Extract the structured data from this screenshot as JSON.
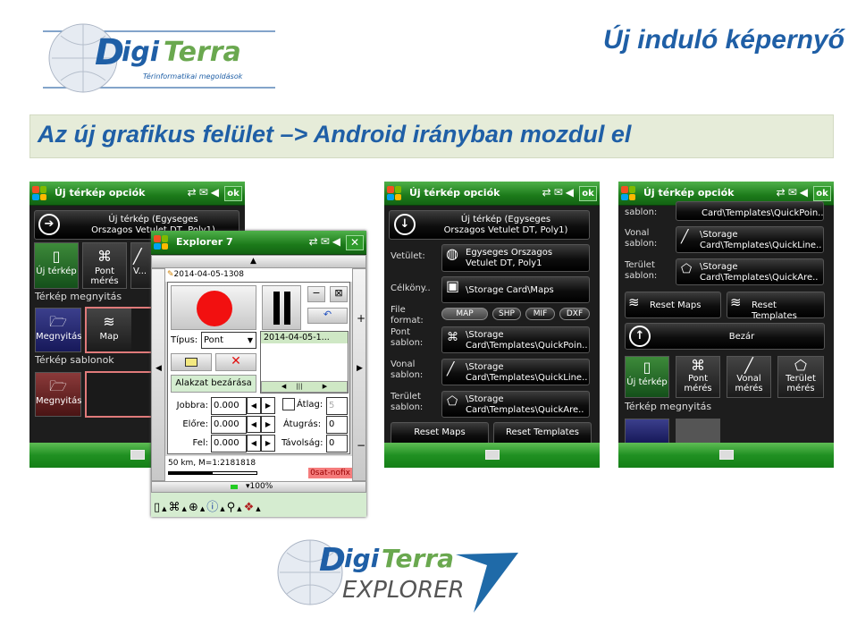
{
  "slide": {
    "title": "Új induló képernyő",
    "banner": "Az új grafikus felület –> Android irányban mozdul el"
  },
  "logos": {
    "top": {
      "name": "DigiTerra",
      "tagline": "Térinformatikai megoldások"
    },
    "bottom": {
      "name": "DigiTerra",
      "product": "EXPLORER",
      "mark": "7"
    }
  },
  "colors": {
    "accent": "#1f5fa6",
    "logo_green": "#6aa84f",
    "titlebar": "#1c7a1a",
    "banner_bg": "#e6ecd9"
  },
  "screen1": {
    "title": "Új térkép opciók",
    "ok": "ok",
    "new_map_line1": "Új térkép (Egyseges",
    "new_map_line2": "Orszagos Vetulet DT, Poly1)",
    "tiles": [
      {
        "label": "Új térkép",
        "icon": "document-icon"
      },
      {
        "label": "Pont mérés",
        "icon": "point-icon"
      },
      {
        "label": "V...",
        "icon": "line-icon"
      }
    ],
    "open_section": "Térkép megnyitás",
    "open_tiles": [
      {
        "label": "Megnyitás",
        "icon": "folder-open-icon"
      },
      {
        "label": "Map",
        "icon": "layers-icon"
      }
    ],
    "templates_section": "Térkép sablonok",
    "template_tiles": [
      {
        "label": "Megnyitás",
        "icon": "folder-open-icon"
      }
    ]
  },
  "explorer": {
    "title": "Explorer 7",
    "close": "✕",
    "file": "2014-04-05-1308",
    "type_label": "Típus:",
    "type_value": "Pont",
    "list_item": "2014-04-05-1...",
    "close_shape": "Alakzat bezárása",
    "right_label": "Jobbra:",
    "right_value": "0.000",
    "forward_label": "Előre:",
    "forward_value": "0.000",
    "up_label": "Fel:",
    "up_value": "0.000",
    "avg_label": "Átlag:",
    "avg_value": "5",
    "skip_label": "Átugrás:",
    "skip_value": "0",
    "dist_label": "Távolság:",
    "dist_value": "0",
    "scale": "50 km, M=1:2181818",
    "gps_status": "0sat-nofix",
    "zoom": "▾100%"
  },
  "screen3": {
    "title": "Új térkép opciók",
    "ok": "ok",
    "new_map_line1": "Új térkép (Egyseges",
    "new_map_line2": "Orszagos Vetulet DT, Poly1)",
    "rows": [
      {
        "label": "Vetület:",
        "line1": "Egyseges Orszagos",
        "line2": "Vetulet DT, Poly1",
        "icon": "globe-icon"
      },
      {
        "label": "Célköny..",
        "line1": "\\Storage Card\\Maps",
        "line2": "",
        "icon": "floppy-icon"
      }
    ],
    "file_format_label": "File format:",
    "formats": [
      "MAP",
      "SHP",
      "MIF",
      "DXF"
    ],
    "templates": [
      {
        "label": "Pont sablon:",
        "line1": "\\Storage",
        "line2": "Card\\Templates\\QuickPoin..",
        "icon": "point-icon"
      },
      {
        "label": "Vonal sablon:",
        "line1": "\\Storage",
        "line2": "Card\\Templates\\QuickLine..",
        "icon": "line-icon"
      },
      {
        "label": "Terület sablon:",
        "line1": "\\Storage",
        "line2": "Card\\Templates\\QuickAre..",
        "icon": "area-icon"
      }
    ],
    "reset_maps": "Reset Maps",
    "reset_templates": "Reset Templates"
  },
  "screen4": {
    "title": "Új térkép opciók",
    "ok": "ok",
    "partial_label": "sablon:",
    "partial_value": "Card\\Templates\\QuickPoin..",
    "templates": [
      {
        "label": "Vonal sablon:",
        "line1": "\\Storage",
        "line2": "Card\\Templates\\QuickLine.."
      },
      {
        "label": "Terület sablon:",
        "line1": "\\Storage",
        "line2": "Card\\Templates\\QuickAre.."
      }
    ],
    "reset_maps": "Reset Maps",
    "reset_templates": "Reset Templates",
    "close": "Bezár",
    "tiles": [
      {
        "label": "Új térkép"
      },
      {
        "label": "Pont mérés"
      },
      {
        "label": "Vonal mérés"
      },
      {
        "label": "Terület mérés"
      }
    ],
    "open_section": "Térkép megnyitás"
  }
}
